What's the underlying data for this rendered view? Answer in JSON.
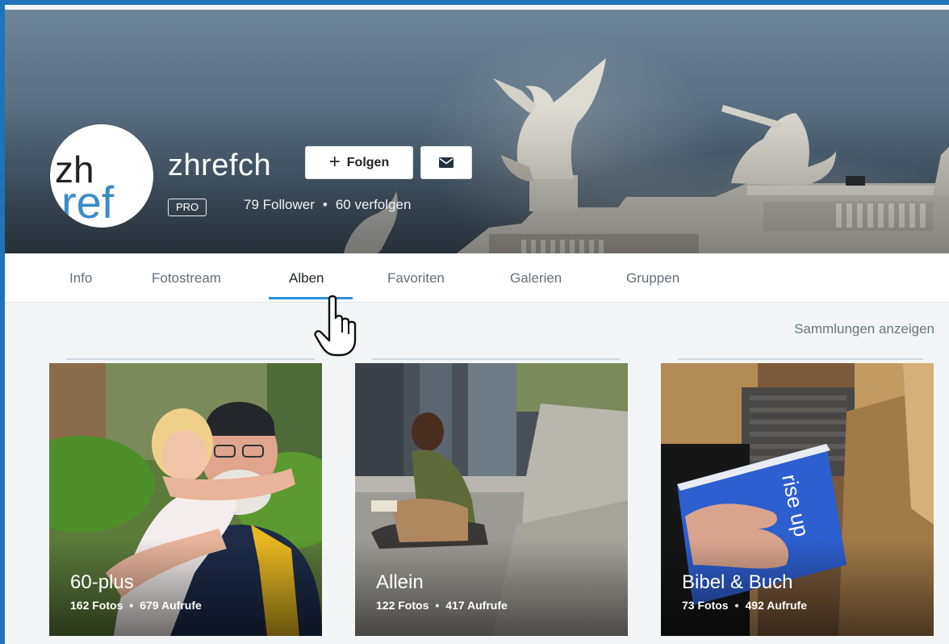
{
  "profile": {
    "username": "zhrefch",
    "badge": "PRO",
    "followers": "79 Follower",
    "following": "60 verfolgen",
    "follow_label": "Folgen",
    "avatar_text_top": "zh",
    "avatar_text_bottom": "ref"
  },
  "tabs": [
    {
      "label": "Info",
      "active": false
    },
    {
      "label": "Fotostream",
      "active": false
    },
    {
      "label": "Alben",
      "active": true
    },
    {
      "label": "Favoriten",
      "active": false
    },
    {
      "label": "Galerien",
      "active": false
    },
    {
      "label": "Gruppen",
      "active": false
    }
  ],
  "collections_link": "Sammlungen anzeigen",
  "albums": [
    {
      "title": "60-plus",
      "photos": "162 Fotos",
      "views": "679 Aufrufe"
    },
    {
      "title": "Allein",
      "photos": "122 Fotos",
      "views": "417 Aufrufe"
    },
    {
      "title": "Bibel & Buch",
      "photos": "73 Fotos",
      "views": "492 Aufrufe"
    }
  ],
  "book_text": "rise up",
  "colors": {
    "accent": "#2f8fd8",
    "frame": "#1f73b7",
    "avatar_zh": "#222222",
    "avatar_ref": "#3a8cc9"
  },
  "icons": [
    "plus-icon",
    "mail-icon",
    "hand-cursor-icon"
  ]
}
